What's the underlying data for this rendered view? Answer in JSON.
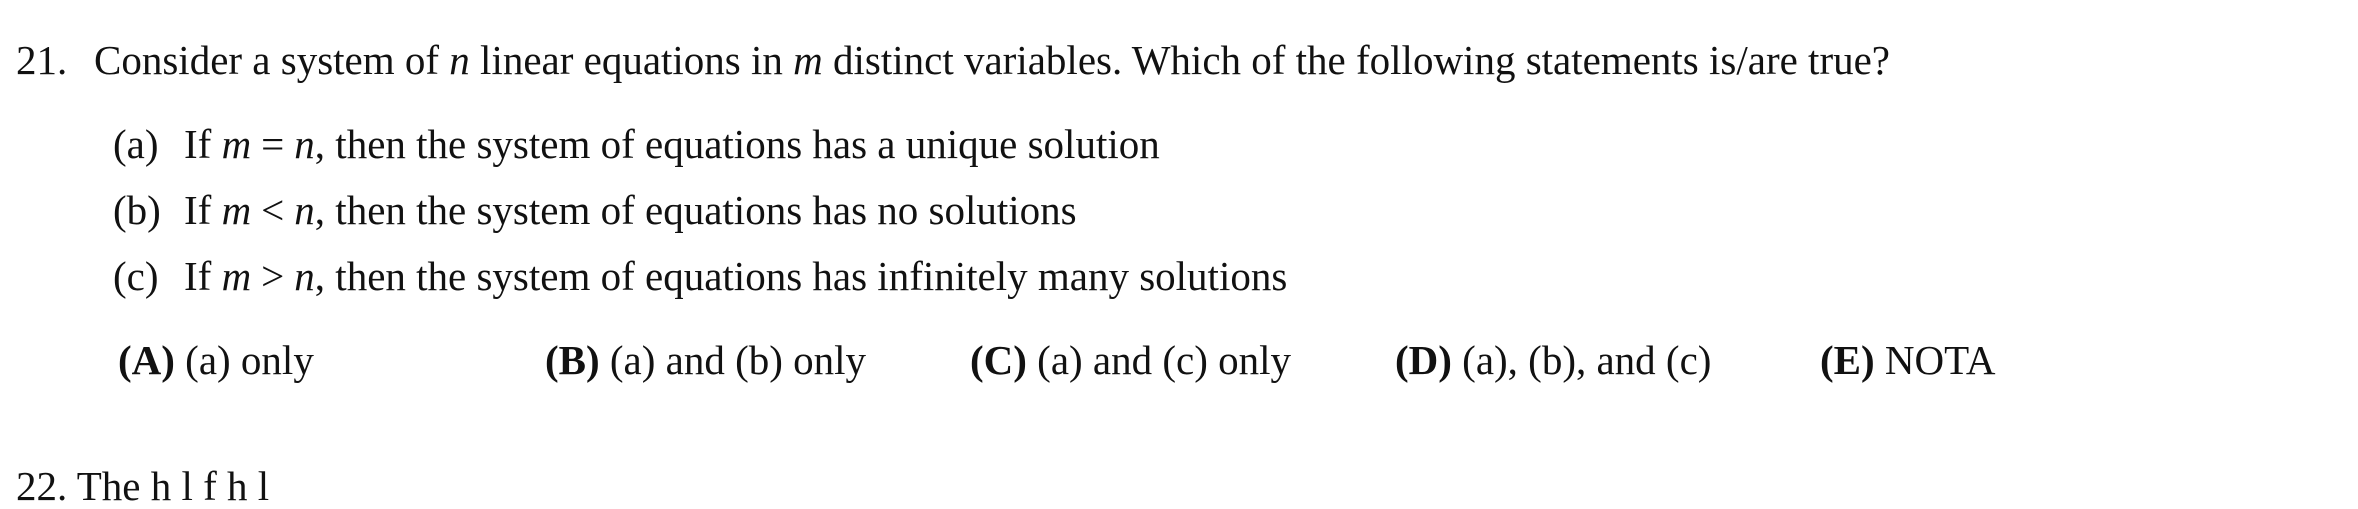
{
  "question": {
    "number": "21.",
    "text_parts": {
      "before_n": "Consider a system of ",
      "n": "n",
      "middle": " linear equations in ",
      "m": "m",
      "after_m": " distinct variables. Which of the following statements is/are true?"
    }
  },
  "statements": [
    {
      "label": "(a)",
      "lead": "If ",
      "var1": "m",
      "op": "=",
      "var2": "n",
      "rest": ", then the system of equations has a unique solution"
    },
    {
      "label": "(b)",
      "lead": "If ",
      "var1": "m",
      "op": "<",
      "var2": "n",
      "rest": ", then the system of equations has no solutions"
    },
    {
      "label": "(c)",
      "lead": "If ",
      "var1": "m",
      "op": ">",
      "var2": "n",
      "rest": ", then the system of equations has infinitely many solutions"
    }
  ],
  "choices": [
    {
      "letter": "(A)",
      "text": " (a) only"
    },
    {
      "letter": "(B)",
      "text": " (a) and (b) only"
    },
    {
      "letter": "(C)",
      "text": " (a) and (c) only"
    },
    {
      "letter": "(D)",
      "text": " (a), (b), and (c)"
    },
    {
      "letter": "(E)",
      "text": " NOTA"
    }
  ],
  "next_question_cut": "22.   The         h      l    f    h  l"
}
